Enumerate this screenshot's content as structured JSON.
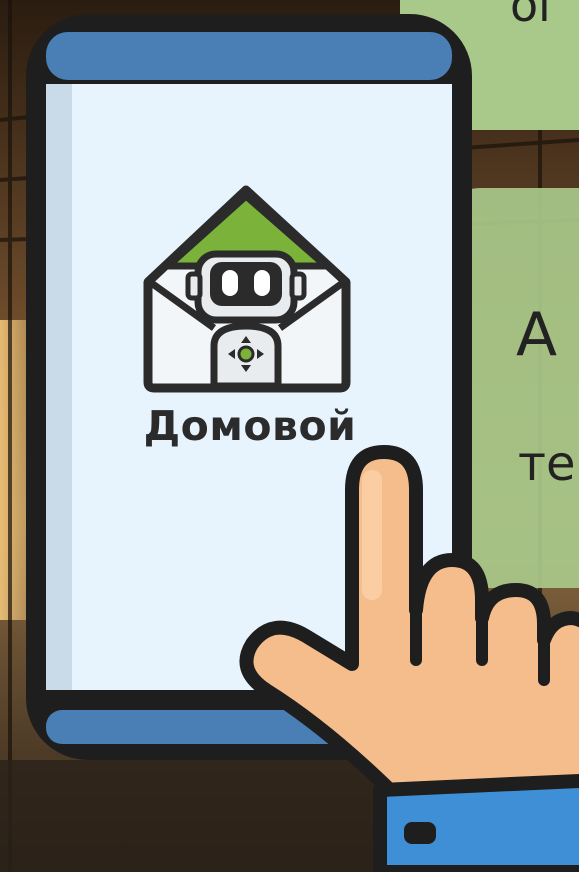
{
  "logo": {
    "app_name": "Домовой",
    "icon": "robot-house-icon"
  },
  "bubbles": {
    "top_fragment": "ог",
    "middle_line1": "А",
    "middle_line2": "те"
  },
  "colors": {
    "phone_frame": "#1e1e1e",
    "phone_bars": "#4a7fb5",
    "screen": "#e8f4fd",
    "roof_green": "#7bb33a",
    "bubble_green": "#a9c98a",
    "skin": "#f6bd8c",
    "cuff_blue": "#3f8fd6"
  },
  "icons": [
    "robot-house-icon",
    "pointing-hand-icon",
    "smartphone-icon"
  ]
}
